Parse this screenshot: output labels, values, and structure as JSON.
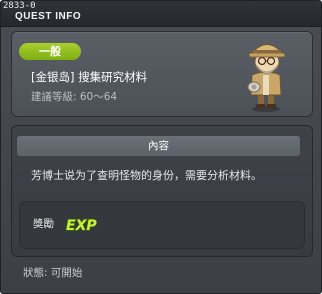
{
  "window": {
    "id_label": "2833-0",
    "title": "QUEST INFO"
  },
  "quest": {
    "category": "一般",
    "title": "[金银岛] 搜集研究材料",
    "level_requirement": "建議等級: 60～64",
    "npc_icon": "professor-npc-icon"
  },
  "content": {
    "section_title": "內容",
    "description": "芳博士说为了查明怪物的身份，需要分析材料。"
  },
  "reward": {
    "label": "獎勵",
    "exp_text": "EXP"
  },
  "status": {
    "text": "狀態:  可開始"
  },
  "colors": {
    "badge_green": "#8dbb1c",
    "exp_green": "#b8e62a",
    "panel": "#4c5157",
    "background": "#3c4046"
  }
}
